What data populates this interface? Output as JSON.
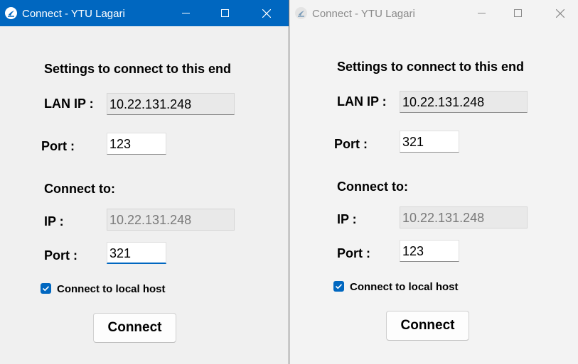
{
  "windows": [
    {
      "title": "Connect - YTU Lagari",
      "heading": "Settings to connect to this end",
      "lan_ip_label": "LAN IP :",
      "lan_ip_value": "10.22.131.248",
      "local_port_label": "Port :",
      "local_port_value": "123",
      "connect_to_heading": "Connect to:",
      "remote_ip_label": "IP :",
      "remote_ip_value": "10.22.131.248",
      "remote_port_label": "Port :",
      "remote_port_value": "321",
      "checkbox_label": "Connect to local host",
      "checkbox_checked": true,
      "connect_button": "Connect",
      "active": true
    },
    {
      "title": "Connect - YTU Lagari",
      "heading": "Settings to connect to this end",
      "lan_ip_label": "LAN IP :",
      "lan_ip_value": "10.22.131.248",
      "local_port_label": "Port :",
      "local_port_value": "321",
      "connect_to_heading": "Connect to:",
      "remote_ip_label": "IP :",
      "remote_ip_value": "10.22.131.248",
      "remote_port_label": "Port :",
      "remote_port_value": "123",
      "checkbox_label": "Connect to local host",
      "checkbox_checked": true,
      "connect_button": "Connect",
      "active": false
    }
  ],
  "colors": {
    "accent": "#0067c0",
    "active_titlebar": "#0067c0",
    "inactive_title_text": "#8a8a8a"
  },
  "icons": {
    "app": "ytu-lagari-logo-icon",
    "minimize": "minimize-icon",
    "maximize": "maximize-icon",
    "close": "close-icon",
    "checkbox": "checkmark-icon"
  }
}
